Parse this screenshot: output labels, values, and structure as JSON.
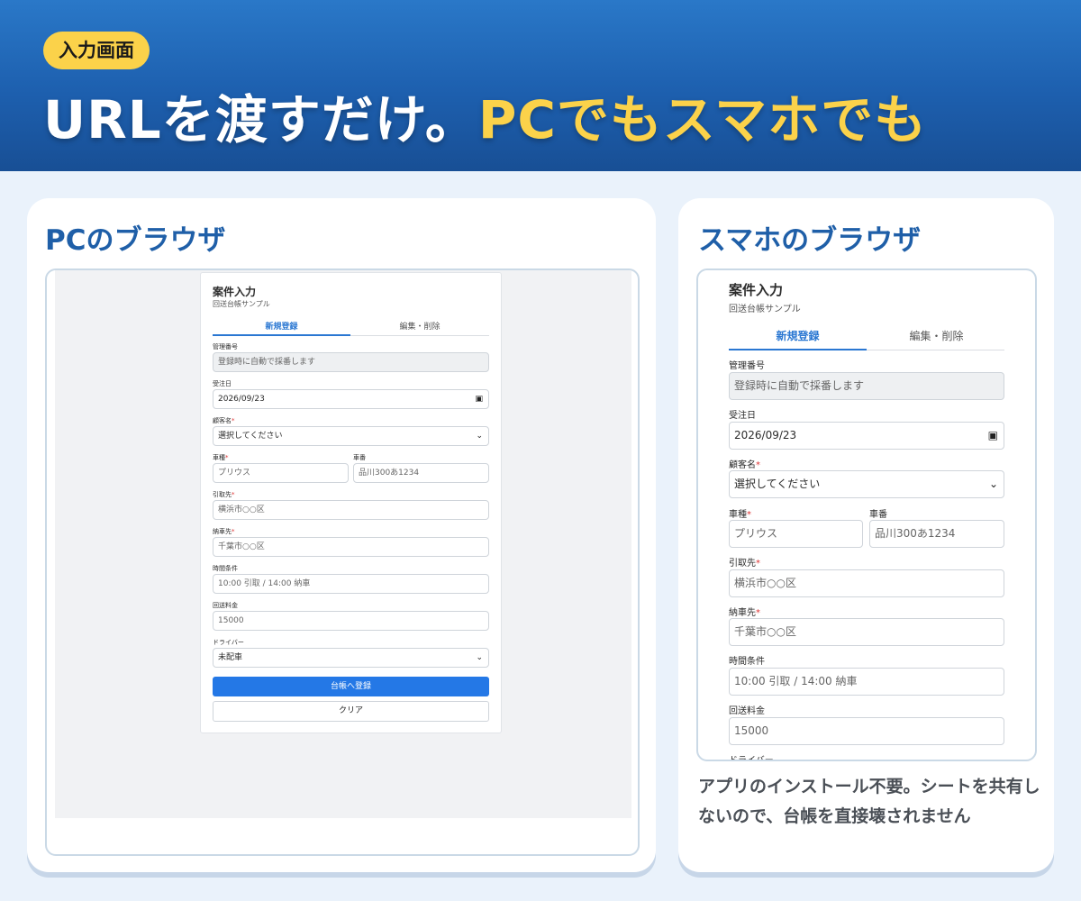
{
  "header": {
    "badge": "入力画面",
    "headline_a": "URLを渡すだけ。",
    "headline_b": "PCでもスマホでも"
  },
  "left_card": {
    "title": "PCのブラウザ"
  },
  "right_card": {
    "title": "スマホのブラウザ",
    "caption": "アプリのインストール不要。シートを共有しないので、台帳を直接壊されません"
  },
  "form": {
    "title": "案件入力",
    "subtitle": "回送台帳サンプル",
    "tabs": {
      "new": "新規登録",
      "edit": "編集・削除"
    },
    "fields": {
      "mgmt_no": {
        "label": "管理番号",
        "value": "登録時に自動で採番します"
      },
      "order_date": {
        "label": "受注日",
        "value": "2026/09/23"
      },
      "customer": {
        "label": "顧客名",
        "value": "選択してください"
      },
      "car_type": {
        "label": "車種",
        "placeholder": "プリウス"
      },
      "car_no": {
        "label": "車番",
        "placeholder": "品川300あ1234"
      },
      "pickup": {
        "label": "引取先",
        "placeholder": "横浜市○○区"
      },
      "delivery": {
        "label": "納車先",
        "placeholder": "千葉市○○区"
      },
      "time": {
        "label": "時間条件",
        "placeholder": "10:00 引取 / 14:00 納車"
      },
      "fee": {
        "label": "回送料金",
        "placeholder": "15000"
      },
      "driver": {
        "label": "ドライバー",
        "value": "未配車"
      }
    },
    "required_mark": "*",
    "buttons": {
      "submit": "台帳へ登録",
      "clear": "クリア"
    }
  },
  "icons": {
    "calendar": "calendar-icon",
    "chevron": "chevron-down-icon"
  },
  "colors": {
    "header": "#1d5fae",
    "accent": "#fbd24a",
    "primary": "#2478e6",
    "title": "#1f5fa8"
  }
}
